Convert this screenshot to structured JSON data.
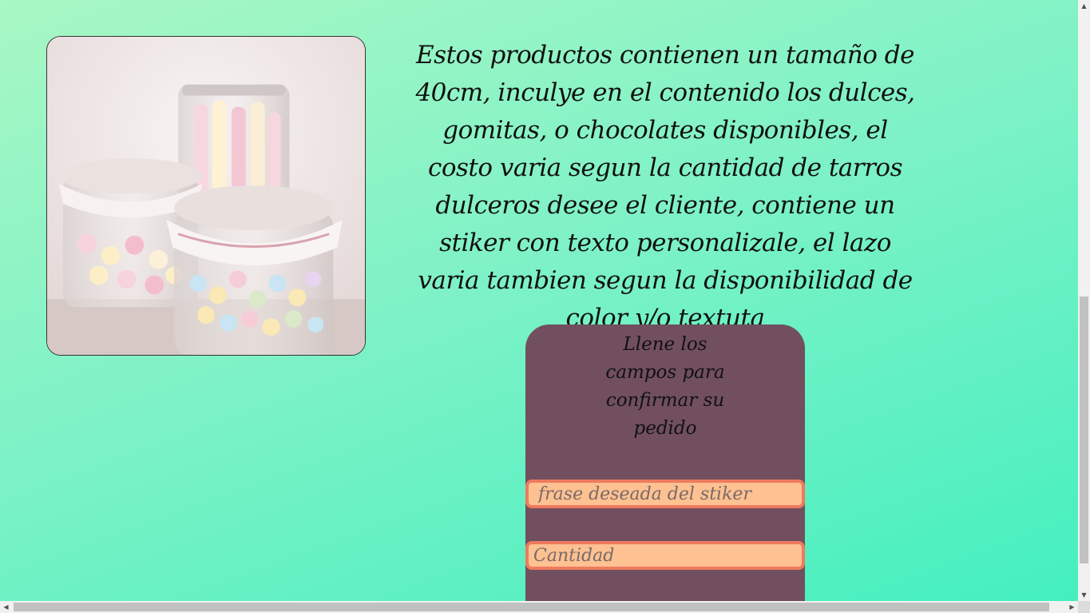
{
  "product": {
    "image_icon": "candy-jars-photo",
    "description": "Estos productos contienen un tamaño de 40cm, inculye en el contenido los dulces, gomitas, o chocolates disponibles, el costo varia segun la cantidad de tarros dulceros desee el cliente, contiene un stiker con texto personalizale, el lazo varia tambien segun la disponibilidad de color y/o textuta"
  },
  "order_form": {
    "title": "Llene los campos para confirmar su pedido",
    "sticker_field": {
      "value": "",
      "placeholder": "frase deseada del stiker"
    },
    "quantity_field": {
      "value": "",
      "placeholder": "Cantidad"
    }
  },
  "colors": {
    "background_start": "#a8f7c4",
    "background_end": "#42efbf",
    "panel": "#714f5e",
    "field_fill": "#fdc192",
    "field_border": "#ee7a5e"
  },
  "scrollbars": {
    "vertical": {
      "up_icon": "▲",
      "down_icon": "▼"
    },
    "horizontal": {
      "left_icon": "◀",
      "right_icon": "▶"
    }
  }
}
